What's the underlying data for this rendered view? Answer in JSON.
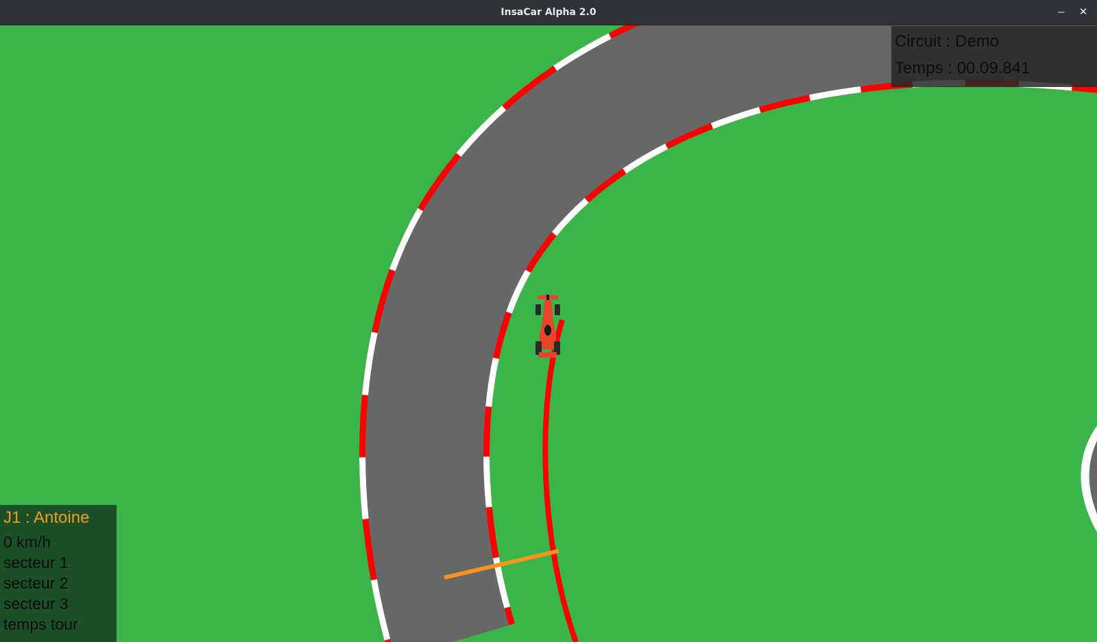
{
  "window": {
    "title": "InsaCar Alpha 2.0",
    "minimize_glyph": "–",
    "close_glyph": "✕"
  },
  "hud": {
    "circuit_label": "Circuit : Demo",
    "time_label": "Temps : 00.09.841"
  },
  "player": {
    "name": "J1 : Antoine",
    "speed": "0 km/h",
    "sector1": "secteur 1",
    "sector2": "secteur 2",
    "sector3": "secteur 3",
    "lap_time": "temps tour"
  },
  "colors": {
    "grass": "#3ab54a",
    "asphalt": "#676767",
    "kerb_red": "#ff0000",
    "kerb_white": "#ffffff",
    "finish_line": "#f7941d",
    "player_name": "#f39a26",
    "car_body": "#e8452a"
  },
  "icons": {
    "car": "formula-car-icon",
    "minimize": "minimize-icon",
    "close": "close-icon"
  }
}
